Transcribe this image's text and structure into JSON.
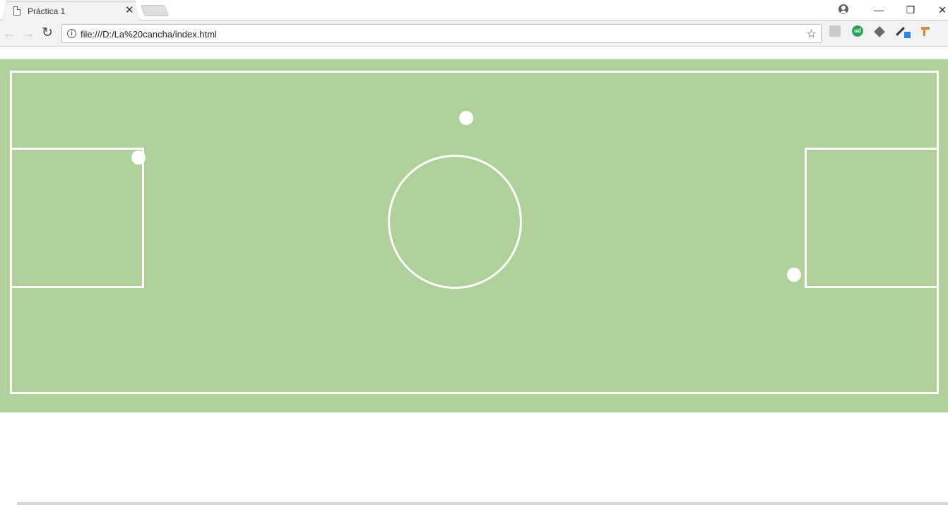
{
  "browser": {
    "tab_title": "Práctica 1",
    "tab_close": "✕",
    "url": "file:///D:/La%20cancha/index.html",
    "icons": [
      "page-icon",
      "close-icon",
      "new-tab",
      "profile-icon",
      "minimize-icon",
      "restore-icon",
      "close-window-icon",
      "back-icon",
      "forward-icon",
      "reload-icon",
      "info-icon",
      "star-icon",
      "pdf-extension-icon",
      "ud-extension-icon",
      "layers-extension-icon",
      "eyedropper-extension-icon",
      "hammer-extension-icon",
      "menu-icon"
    ],
    "ud_label": "ud",
    "window_controls": {
      "minimize": "—",
      "restore": "❐",
      "close": "✕"
    },
    "nav": {
      "back": "←",
      "forward": "→",
      "reload": "↻"
    },
    "info_glyph": "i",
    "star_glyph": "☆",
    "menu_glyph": "⋮"
  },
  "page": {
    "field_color": "#afd09b",
    "line_color": "#ffffff",
    "elements": [
      "field-boundary",
      "left-penalty-area",
      "right-penalty-area",
      "center-circle",
      "ball-top",
      "ball-left",
      "ball-right"
    ]
  }
}
